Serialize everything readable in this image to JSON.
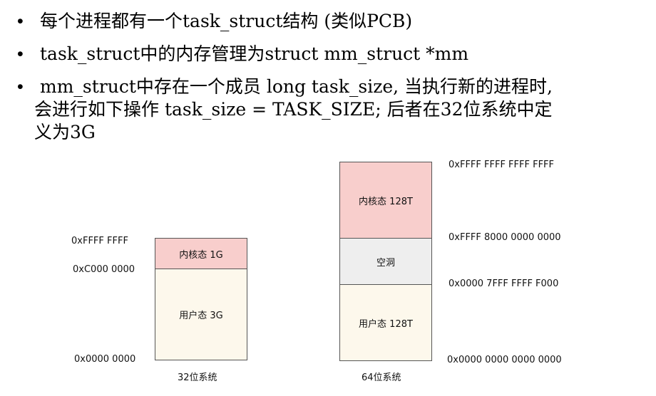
{
  "bullets": [
    {
      "lines": [
        "每个进程都有一个task_struct结构 (类似PCB)"
      ]
    },
    {
      "lines": [
        "task_struct中的内存管理为struct mm_struct *mm"
      ]
    },
    {
      "lines": [
        "mm_struct中存在一个成员 long task_size, 当执行新的进程时,",
        "会进行如下操作 task_size = TASK_SIZE; 后者在32位系统中定",
        "义为3G"
      ]
    }
  ],
  "diagram32": {
    "caption": "32位系统",
    "kernel_label": "内核态 1G",
    "user_label": "用户态 3G",
    "addr_top": "0xFFFF FFFF",
    "addr_split": "0xC000 0000",
    "addr_bottom": "0x0000 0000"
  },
  "diagram64": {
    "caption": "64位系统",
    "kernel_label": "内核态 128T",
    "hole_label": "空洞",
    "user_label": "用户态 128T",
    "addr_top": "0xFFFF FFFF FFFF FFFF",
    "addr_kernel_start": "0xFFFF 8000 0000 0000",
    "addr_user_end": "0x0000 7FFF FFFF F000",
    "addr_bottom": "0x0000 0000 0000 0000"
  },
  "colors": {
    "kernel": "#f8cecc",
    "user": "#fdf8ec",
    "hole": "#eeeeee",
    "border": "#555555"
  }
}
